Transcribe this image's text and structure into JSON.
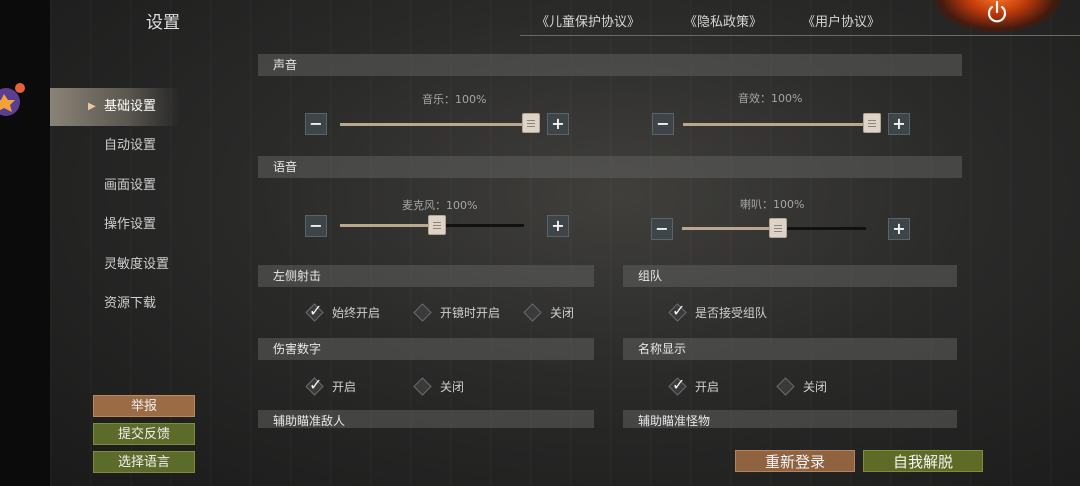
{
  "header": {
    "title": "设置",
    "links": [
      "《儿童保护协议》",
      "《隐私政策》",
      "《用户协议》"
    ]
  },
  "nav": {
    "items": [
      "基础设置",
      "自动设置",
      "画面设置",
      "操作设置",
      "灵敏度设置",
      "资源下载"
    ],
    "active": "基础设置"
  },
  "side_buttons": {
    "report": "举报",
    "feedback": "提交反馈",
    "language": "选择语言"
  },
  "sound": {
    "title": "声音",
    "music": {
      "label": "音乐：100%",
      "value": 100,
      "fill": 0.98
    },
    "sfx": {
      "label": "音效：100%",
      "value": 100,
      "fill": 0.98
    }
  },
  "voice": {
    "title": "语音",
    "mic": {
      "label": "麦克风：100%",
      "value": 100,
      "fill": 0.53
    },
    "speaker": {
      "label": "喇叭：100%",
      "value": 100,
      "fill": 0.53
    }
  },
  "left_fire": {
    "title": "左侧射击",
    "options": [
      {
        "label": "始终开启",
        "checked": true
      },
      {
        "label": "开镜时开启",
        "checked": false
      },
      {
        "label": "关闭",
        "checked": false
      }
    ]
  },
  "team": {
    "title": "组队",
    "options": [
      {
        "label": "是否接受组队",
        "checked": true
      }
    ]
  },
  "damage_numbers": {
    "title": "伤害数字",
    "options": [
      {
        "label": "开启",
        "checked": true
      },
      {
        "label": "关闭",
        "checked": false
      }
    ]
  },
  "name_display": {
    "title": "名称显示",
    "options": [
      {
        "label": "开启",
        "checked": true
      },
      {
        "label": "关闭",
        "checked": false
      }
    ]
  },
  "aim_assist_enemy": {
    "title": "辅助瞄准敌人"
  },
  "aim_assist_monster": {
    "title": "辅助瞄准怪物"
  },
  "actions": {
    "relogin": "重新登录",
    "unstuck": "自我解脱"
  }
}
